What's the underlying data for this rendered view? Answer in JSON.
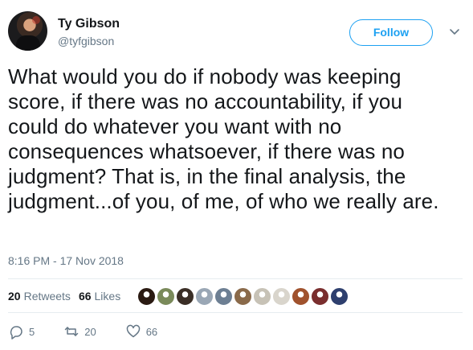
{
  "author": {
    "display_name": "Ty Gibson",
    "handle": "@tyfgibson",
    "avatar_icon": "profile-photo"
  },
  "follow_button": {
    "label": "Follow",
    "color": "#1da1f2"
  },
  "menu": {
    "icon": "chevron-down-icon"
  },
  "tweet": {
    "text": "What would you do if nobody was keeping score, if there was no accountability, if you could do whatever you want with no consequences whatsoever, if there was no judgment? That is, in the final analysis, the judgment...of you, of me, of who we really are.",
    "timestamp": "8:16 PM - 17 Nov 2018"
  },
  "stats": {
    "retweets_count": "20",
    "retweets_label": "Retweets",
    "likes_count": "66",
    "likes_label": "Likes"
  },
  "facepile": {
    "colors": [
      "#2a1a12",
      "#7a8a5a",
      "#3a2e26",
      "#9aa7b5",
      "#6d7f93",
      "#8a6a4a",
      "#c7c2b6",
      "#d9d5cc",
      "#a0522d",
      "#7a2e2e",
      "#2e3f6e"
    ]
  },
  "actions": {
    "reply_count": "5",
    "retweet_count": "20",
    "like_count": "66"
  }
}
